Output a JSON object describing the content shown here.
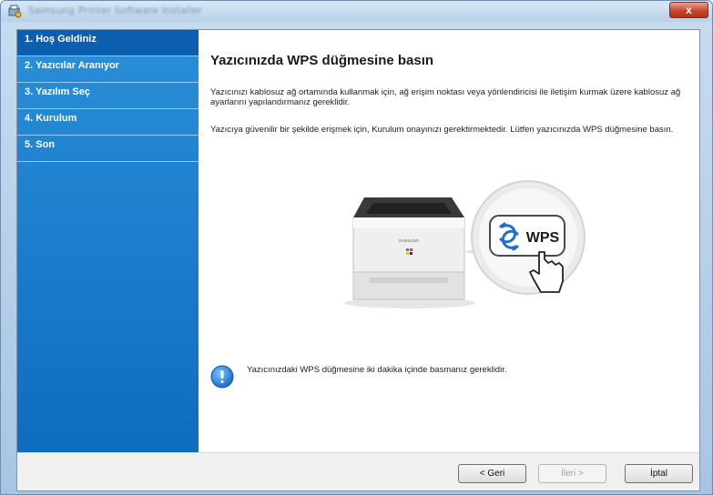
{
  "window": {
    "title": "Samsung Printer Software Installer",
    "close_label": "x"
  },
  "sidebar": {
    "steps": [
      {
        "label": "1. Hoş Geldiniz"
      },
      {
        "label": "2. Yazıcılar Aranıyor"
      },
      {
        "label": "3. Yazılım Seç"
      },
      {
        "label": "4. Kurulum"
      },
      {
        "label": "5. Son"
      }
    ],
    "active_index": 0
  },
  "main": {
    "title": "Yazıcınızda WPS düğmesine basın",
    "paragraph1": "Yazıcınızı kablosuz ağ ortamında kullanmak için, ağ erişim noktası veya yönlendiricisi ile iletişim kurmak üzere kablosuz ağ ayarlarını yapılandırmanız gereklidir.",
    "paragraph2": "Yazıcıya güvenilir bir şekilde erişmek için, Kurulum onayınızı gerektirmektedir. Lütfen yazıcınızda WPS düğmesine basın.",
    "illustration": {
      "printer_brand": "SAMSUNG",
      "wps_label": "WPS"
    },
    "info_text": "Yazıcınızdaki WPS düğmesine iki dakika içinde basmanız gereklidir."
  },
  "footer": {
    "back_label": "< Geri",
    "next_label": "İleri >",
    "cancel_label": "İptal"
  },
  "colors": {
    "sidebar": "#1a7fd0",
    "sidebar_active": "#0b5fae",
    "close_button": "#c7452d",
    "info_icon": "#2f8fe0"
  }
}
